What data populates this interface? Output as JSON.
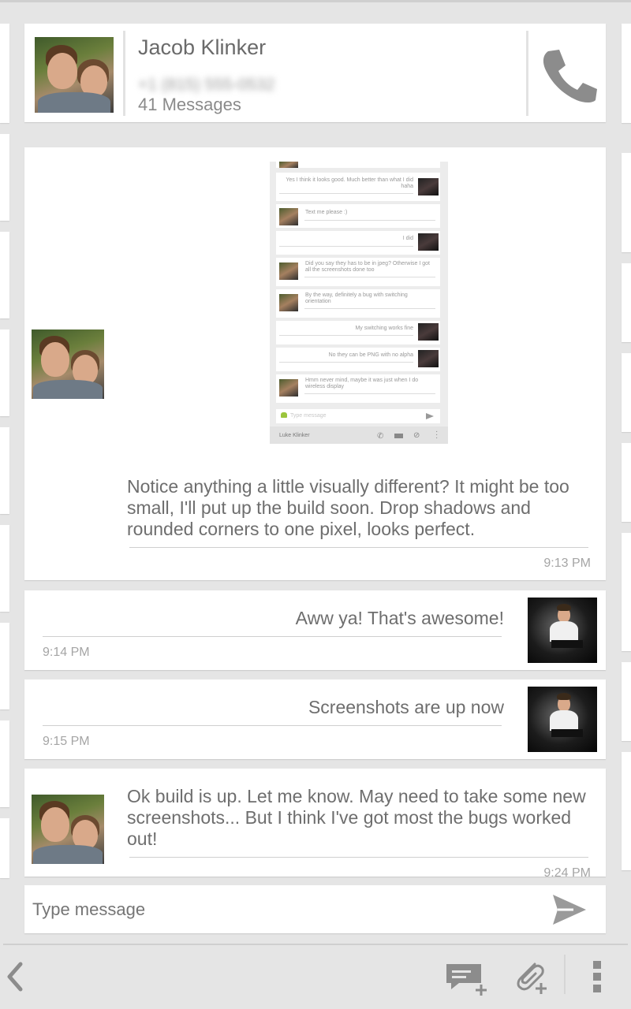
{
  "contact": {
    "name": "Jacob Klinker",
    "phone_blurred": "+1 (815) 555-0532",
    "message_count": "41 Messages"
  },
  "messages": [
    {
      "text": "Notice anything a little visually different? It might be too small, I'll put up the build soon. Drop shadows and rounded corners to one pixel, looks perfect.",
      "time": "9:13 PM"
    },
    {
      "text": "Aww ya! That's awesome!",
      "time": "9:14 PM"
    },
    {
      "text": "Screenshots are up now",
      "time": "9:15 PM"
    },
    {
      "text": "Ok build is up. Let me know. May need to take some new screenshots... But I think I've got most the bugs worked out!",
      "time": "9:24 PM"
    }
  ],
  "composer": {
    "placeholder": "Type message"
  },
  "mini_screenshot": {
    "messages": [
      "Yes I think it looks good. Much better than what I did haha",
      "Text me please :)",
      "I did",
      "Did you say they has to be in jpeg? Otherwise I got all the screenshots done too",
      "By the way, definitely a bug with switching orientation",
      "My switching works fine",
      "No they can be PNG with no alpha",
      "Hmm never mind, maybe it was just when I do wireless display"
    ],
    "placeholder": "Type message",
    "contact": "Luke Klinker"
  },
  "icons": {
    "call": "phone-icon",
    "send": "send-icon",
    "back": "back-arrow-icon",
    "new_message": "new-message-icon",
    "attach": "attach-icon",
    "menu": "overflow-menu-icon"
  },
  "colors": {
    "background": "#e5e5e5",
    "card": "#ffffff",
    "text": "#6e6e6e",
    "time": "#a5a5a5"
  }
}
